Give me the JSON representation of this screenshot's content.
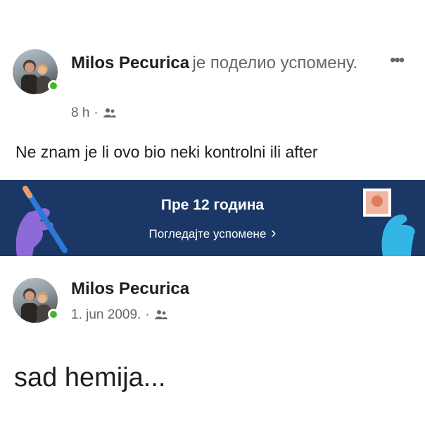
{
  "post1": {
    "author": "Milos Pecurica",
    "action": "је поделио успомену.",
    "time": "8 h",
    "separator": "·",
    "audience_icon": "friends-icon",
    "body": "Ne znam je li ovo bio neki kontrolni ili after",
    "more_icon": "more-options-icon",
    "more_label": "•••"
  },
  "memory": {
    "title": "Пре 12 година",
    "link_label": "Погледајте успомене",
    "link_chevron": "›",
    "background": "#1b3766"
  },
  "post2": {
    "author": "Milos Pecurica",
    "date": "1. jun 2009.",
    "separator": "·",
    "audience_icon": "friends-icon",
    "body": "sad hemija..."
  },
  "colors": {
    "online": "#42b72a",
    "secondary_text": "#65676b",
    "primary_text": "#1c1e21"
  }
}
